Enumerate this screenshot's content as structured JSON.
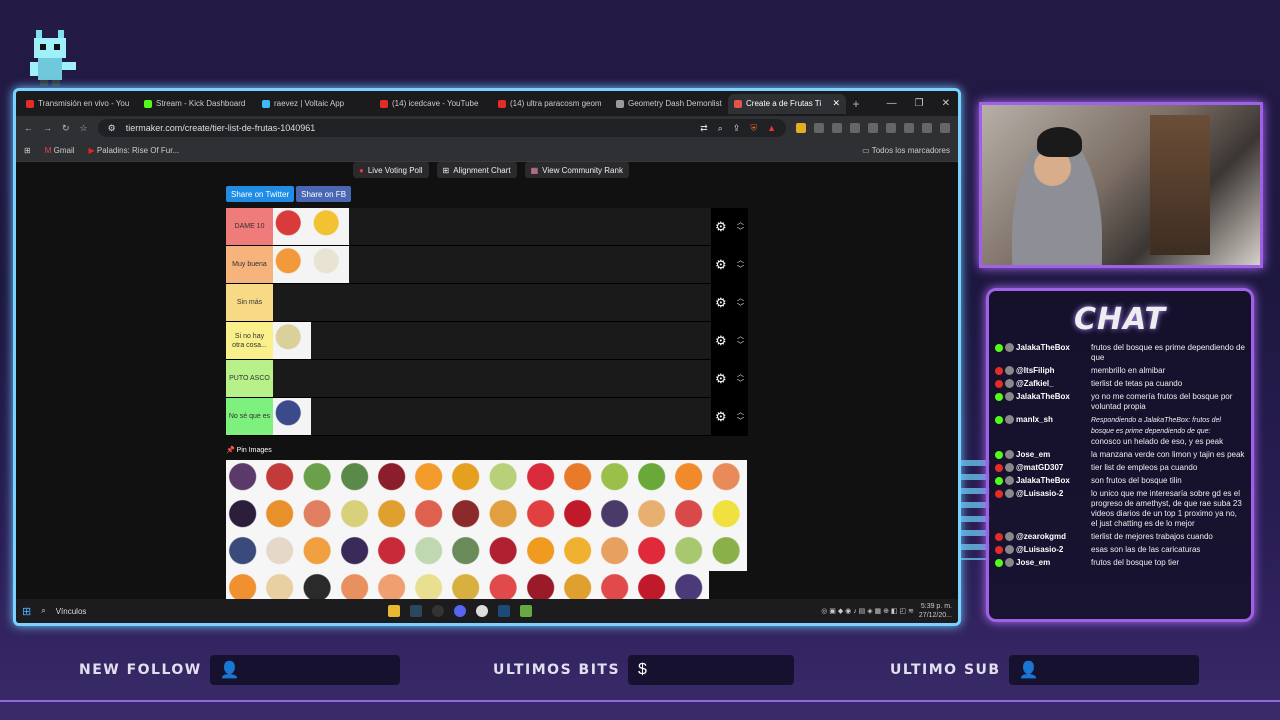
{
  "browser": {
    "tabs": [
      {
        "label": "Transmisión en vivo - You",
        "color": "#e52d27"
      },
      {
        "label": "Stream - Kick Dashboard",
        "color": "#53fc18"
      },
      {
        "label": "raevez | Voltaic App",
        "color": "#3db7ff"
      },
      {
        "label": "(14) icedcave - YouTube",
        "color": "#e52d27"
      },
      {
        "label": "(14) ultra paracosm geom",
        "color": "#e52d27"
      },
      {
        "label": "Geometry Dash Demonlist",
        "color": "#999999"
      },
      {
        "label": "Create a de Frutas Ti",
        "color": "#e5534b",
        "active": true
      }
    ],
    "new_tab": "+",
    "url": "tiermaker.com/create/tier-list-de-frutas-1040961",
    "bookmarks": [
      {
        "label": "Gmail"
      },
      {
        "label": "Paladins: Rise Of Fur..."
      }
    ],
    "all_bookmarks": "Todos los marcadores"
  },
  "page": {
    "buttons": {
      "live_poll": "Live Voting Poll",
      "alignment": "Alignment Chart",
      "community": "View Community Rank"
    },
    "share_twitter": "Share on Twitter",
    "share_fb": "Share on FB",
    "pin_images": "Pin Images",
    "tiers": [
      {
        "label": "DAME 10",
        "color": "#f07b7b",
        "items": [
          "#d93a3a",
          "#f2c230"
        ]
      },
      {
        "label": "Muy buena",
        "color": "#f6b37c",
        "items": [
          "#f29a3b",
          "#e9e3d4"
        ]
      },
      {
        "label": "Sin más",
        "color": "#f8d985",
        "items": []
      },
      {
        "label": "Si no hay otra cosa...",
        "color": "#f9f08c",
        "items": [
          "#d9d09a"
        ]
      },
      {
        "label": "PUTO ASCO",
        "color": "#b8f08a",
        "items": []
      },
      {
        "label": "No sé que es",
        "color": "#7ef07e",
        "items": [
          "#3a4a8a"
        ]
      }
    ],
    "pool": [
      "#5b3a6a",
      "#c23a3a",
      "#6ba04a",
      "#5a8a4a",
      "#8a1e2a",
      "#f29a2a",
      "#e6a020",
      "#b9d07a",
      "#d82a3a",
      "#e97a2a",
      "#9bc04a",
      "#6aa83a",
      "#f08a2a",
      "#e98a5a",
      "#2a1e3a",
      "#e8902a",
      "#e08060",
      "#d8d07a",
      "#e0a030",
      "#e06050",
      "#8a2a2a",
      "#e0a040",
      "#e04040",
      "#c01a2a",
      "#4a3a6a",
      "#e8b070",
      "#d84a4a",
      "#f0e040",
      "#3a4a7a",
      "#e6d8c8",
      "#f0a040",
      "#3a2a5a",
      "#c82a3a",
      "#c0d8b0",
      "#6a8a5a",
      "#b02030",
      "#f09a20",
      "#f0b030",
      "#e8a060",
      "#e02a3a",
      "#a8c870",
      "#8ab04a",
      "#f09030",
      "#e8d0a0",
      "#2a2a2a",
      "#e89060",
      "#f0a070",
      "#e8e090",
      "#d8b040",
      "#e04a4a",
      "#9a1a2a",
      "#e0a030",
      "#e04a4a",
      "#c01a2a",
      "#4a3a7a"
    ]
  },
  "taskbar": {
    "search": "Vínculos",
    "time": "5:39 p. m.",
    "date": "27/12/20..."
  },
  "chat": {
    "title": "CHAT",
    "messages": [
      {
        "user": "JalakaTheBox",
        "platform": "#53fc18",
        "text": "frutos del bosque es prime dependiendo de que"
      },
      {
        "user": "@ItsFiliph",
        "platform": "#e52d27",
        "text": "membrillo en almibar"
      },
      {
        "user": "@Zafkiel_",
        "platform": "#e52d27",
        "text": "tierlist de tetas pa cuando"
      },
      {
        "user": "JalakaTheBox",
        "platform": "#53fc18",
        "text": "yo no me comería frutos del bosque por voluntad propia"
      },
      {
        "user": "manlx_sh",
        "platform": "#53fc18",
        "reply": "Respondiendo a JalakaTheBox: frutos del bosque es prime dependiendo de que:",
        "text": "conosco un helado de eso, y es peak"
      },
      {
        "user": "Jose_em",
        "platform": "#53fc18",
        "text": "la manzana verde con limon y tajin es peak"
      },
      {
        "user": "@matGD307",
        "platform": "#e52d27",
        "text": "tier list de empleos pa cuando"
      },
      {
        "user": "JalakaTheBox",
        "platform": "#53fc18",
        "text": "son frutos del bosque tilin"
      },
      {
        "user": "@Luisasio-2",
        "platform": "#e52d27",
        "text": "lo unico que me interesaría sobre gd es el progreso de amethyst, de que rae suba 23 videos diarios de un top 1 proximo ya no, el just chatting es de lo mejor"
      },
      {
        "user": "@zearokgmd",
        "platform": "#e52d27",
        "text": "tierlist de mejores trabajos cuando"
      },
      {
        "user": "@Luisasio-2",
        "platform": "#e52d27",
        "text": "esas son las de las caricaturas"
      },
      {
        "user": "Jose_em",
        "platform": "#53fc18",
        "text": "frutos del bosque top tier"
      }
    ]
  },
  "overlay": {
    "new_follow": "NEW FOLLOW",
    "ultimos_bits": "ULTIMOS BITS",
    "ultimo_sub": "ULTIMO SUB"
  }
}
